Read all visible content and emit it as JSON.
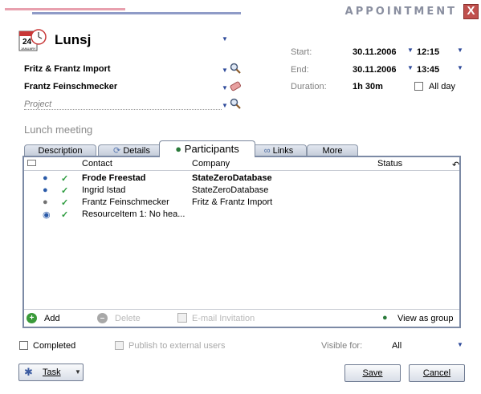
{
  "window": {
    "title": "APPOINTMENT",
    "close": "X"
  },
  "header": {
    "subject": "Lunsj",
    "calendar_day": "24",
    "calendar_month": "JANUARY"
  },
  "fields": {
    "company": "Fritz & Frantz Import",
    "contact": "Frantz Feinschmecker",
    "project_placeholder": "Project"
  },
  "times": {
    "start_label": "Start:",
    "start_date": "30.11.2006",
    "start_time": "12:15",
    "end_label": "End:",
    "end_date": "30.11.2006",
    "end_time": "13:45",
    "duration_label": "Duration:",
    "duration": "1h 30m",
    "allday_label": "All day"
  },
  "description_title": "Lunch meeting",
  "tabs": {
    "description": "Description",
    "details": "Details",
    "participants": "Participants",
    "links": "Links",
    "more": "More"
  },
  "grid": {
    "headers": {
      "contact": "Contact",
      "company": "Company",
      "status": "Status"
    },
    "rows": [
      {
        "contact": "Frode Freestad",
        "company": "StateZeroDatabase",
        "bold": true
      },
      {
        "contact": "Ingrid Istad",
        "company": "StateZeroDatabase"
      },
      {
        "contact": "Frantz Feinschmecker",
        "company": "Fritz & Frantz Import"
      },
      {
        "contact": "ResourceItem 1: No hea...",
        "company": ""
      }
    ],
    "actions": {
      "add": "Add",
      "delete": "Delete",
      "email": "E-mail Invitation",
      "view_group": "View as group"
    }
  },
  "footer": {
    "completed": "Completed",
    "publish": "Publish to external users",
    "visible_label": "Visible for:",
    "visible_value": "All",
    "task": "Task",
    "save": "Save",
    "cancel": "Cancel"
  },
  "colors": {
    "stripe_pink": "#e8a0ae",
    "stripe_blue": "#8f9bc7",
    "check_green": "#2a9a3c",
    "close_red": "#c0504d"
  }
}
